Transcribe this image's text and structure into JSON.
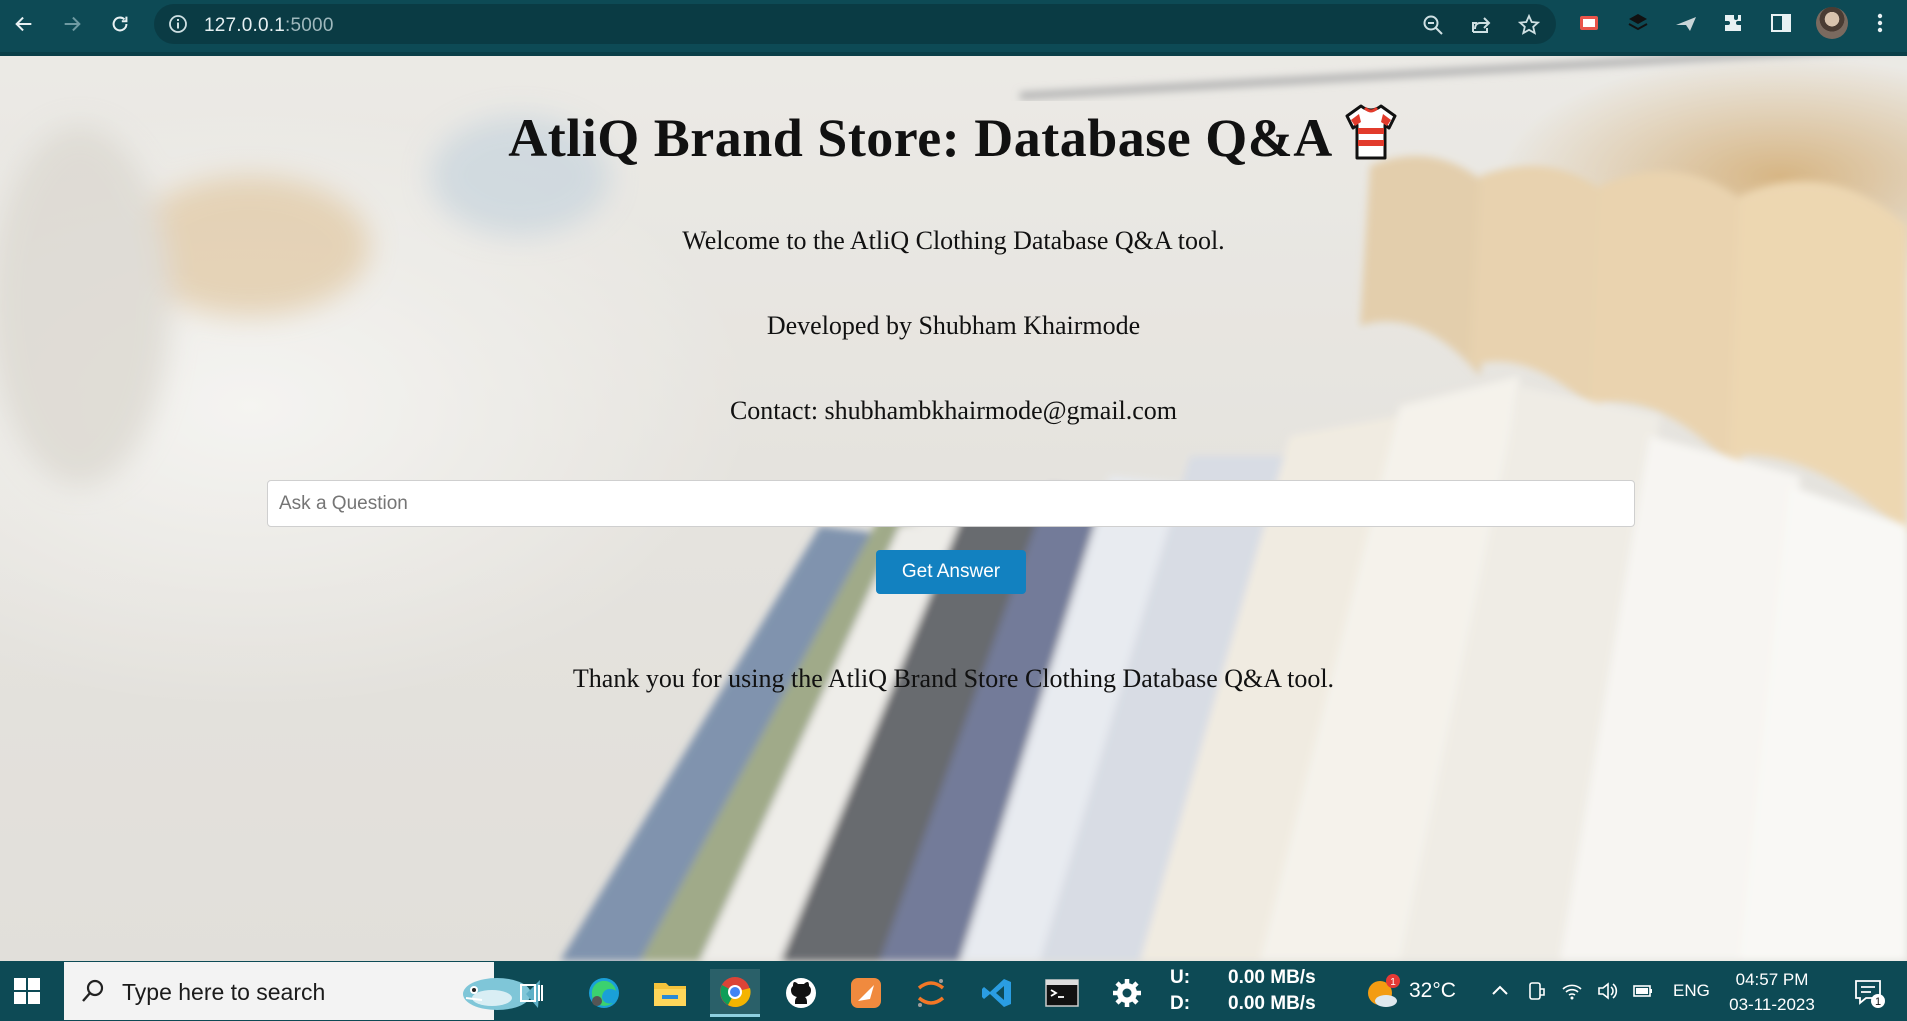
{
  "browser": {
    "url_host": "127.0.0.1",
    "url_port": ":5000"
  },
  "page": {
    "title": "AtliQ Brand Store: Database Q&A",
    "title_icon": "t-shirt-icon",
    "welcome": "Welcome to the AtliQ Clothing Database Q&A tool.",
    "developer": "Developed by Shubham Khairmode",
    "contact": "Contact: shubhambkhairmode@gmail.com",
    "question_placeholder": "Ask a Question",
    "question_value": "",
    "button_label": "Get Answer",
    "thanks": "Thank you for using the AtliQ Brand Store Clothing Database Q&A tool.",
    "accent_color": "#1281c0"
  },
  "taskbar": {
    "search_placeholder": "Type here to search",
    "upload_label": "U:",
    "upload_value": "0.00 MB/s",
    "download_label": "D:",
    "download_value": "0.00 MB/s",
    "weather_badge": "1",
    "temperature": "32°C",
    "language": "ENG",
    "time": "04:57 PM",
    "date": "03-11-2023",
    "notification_count": "1",
    "apps": [
      "task-view-icon",
      "edge-icon",
      "file-explorer-icon",
      "chrome-icon",
      "github-icon",
      "app-icon",
      "jupyter-icon",
      "vscode-icon",
      "terminal-icon",
      "settings-icon"
    ]
  }
}
